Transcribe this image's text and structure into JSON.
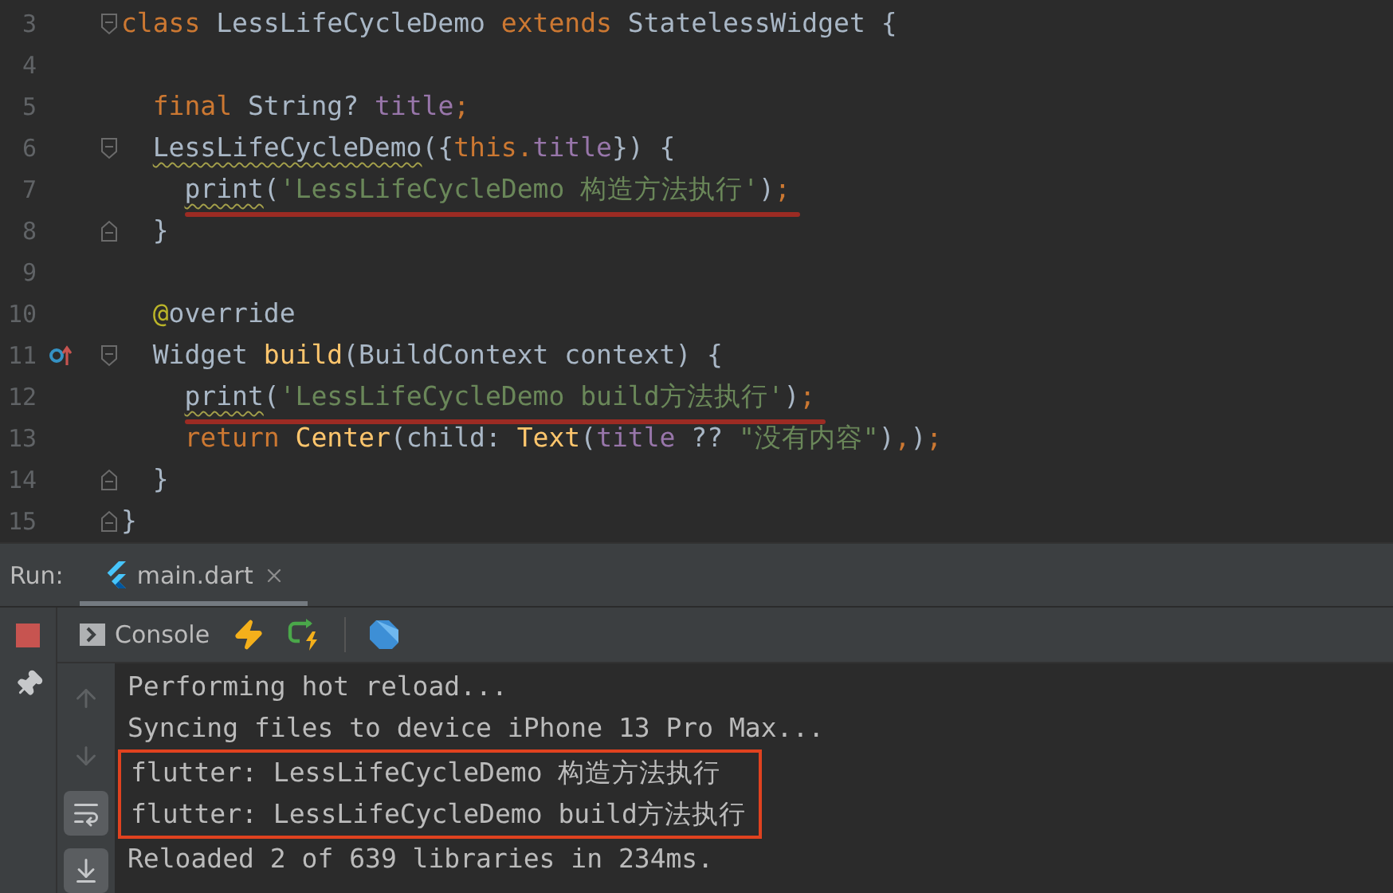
{
  "editor": {
    "lines": [
      {
        "number": "3",
        "fold_start": true,
        "tokens": [
          {
            "kind": "keyword",
            "text": "class "
          },
          {
            "kind": "plain",
            "text": "LessLifeCycleDemo "
          },
          {
            "kind": "keyword",
            "text": "extends "
          },
          {
            "kind": "plain",
            "text": "StatelessWidget {"
          }
        ],
        "children": [
          {
            "number": "4"
          },
          {
            "number": "5",
            "tokens": [
              {
                "kind": "keyword",
                "text": "final "
              },
              {
                "kind": "plain",
                "text": "String? "
              },
              {
                "kind": "field",
                "text": "title"
              },
              {
                "kind": "keyword",
                "text": ";"
              }
            ]
          },
          {
            "number": "6",
            "fold_start": true,
            "tokens": [
              {
                "kind": "plain",
                "text": "LessLifeCycleDemo",
                "warn": true
              },
              {
                "kind": "plain",
                "text": "({"
              },
              {
                "kind": "keyword",
                "text": "this."
              },
              {
                "kind": "field",
                "text": "title"
              },
              {
                "kind": "plain",
                "text": "}) {"
              }
            ],
            "children": [
              {
                "number": "7",
                "error": true,
                "tokens": [
                  {
                    "kind": "plain",
                    "text": "print",
                    "warn": true
                  },
                  {
                    "kind": "plain",
                    "text": "("
                  },
                  {
                    "kind": "string",
                    "text": "'LessLifeCycleDemo 构造方法执行'"
                  },
                  {
                    "kind": "plain",
                    "text": ")"
                  },
                  {
                    "kind": "keyword",
                    "text": ";"
                  }
                ]
              }
            ]
          },
          {
            "number": "8",
            "fold_end": true,
            "tokens": [
              {
                "kind": "plain",
                "text": "}"
              }
            ]
          },
          {
            "number": "9"
          },
          {
            "number": "10",
            "tokens": [
              {
                "kind": "annotation",
                "text": "@"
              },
              {
                "kind": "plain",
                "text": "override"
              }
            ]
          },
          {
            "number": "11",
            "fold_start": true,
            "overrides": true,
            "tokens": [
              {
                "kind": "plain",
                "text": "Widget "
              },
              {
                "kind": "function",
                "text": "build"
              },
              {
                "kind": "plain",
                "text": "(BuildContext context) {"
              }
            ],
            "children": [
              {
                "number": "12",
                "error": true,
                "tokens": [
                  {
                    "kind": "plain",
                    "text": "print",
                    "warn": true
                  },
                  {
                    "kind": "plain",
                    "text": "("
                  },
                  {
                    "kind": "string",
                    "text": "'LessLifeCycleDemo build方法执行'"
                  },
                  {
                    "kind": "plain",
                    "text": ")"
                  },
                  {
                    "kind": "keyword",
                    "text": ";"
                  }
                ]
              },
              {
                "number": "13",
                "tokens": [
                  {
                    "kind": "keyword",
                    "text": "return "
                  },
                  {
                    "kind": "function",
                    "text": "Center"
                  },
                  {
                    "kind": "plain",
                    "text": "(child: "
                  },
                  {
                    "kind": "function",
                    "text": "Text"
                  },
                  {
                    "kind": "plain",
                    "text": "("
                  },
                  {
                    "kind": "field",
                    "text": "title"
                  },
                  {
                    "kind": "plain",
                    "text": " ?? "
                  },
                  {
                    "kind": "string",
                    "text": "\"没有内容\""
                  },
                  {
                    "kind": "plain",
                    "text": ")"
                  },
                  {
                    "kind": "keyword",
                    "text": ","
                  },
                  {
                    "kind": "plain",
                    "text": ")"
                  },
                  {
                    "kind": "keyword",
                    "text": ";"
                  }
                ]
              }
            ]
          },
          {
            "number": "14",
            "fold_end": true,
            "tokens": [
              {
                "kind": "plain",
                "text": "}"
              }
            ]
          }
        ]
      },
      {
        "number": "15",
        "fold_end": true,
        "tokens": [
          {
            "kind": "plain",
            "text": "}"
          }
        ]
      }
    ]
  },
  "run_panel": {
    "label": "Run:",
    "tabs": [
      {
        "label": "main.dart",
        "selected": true
      }
    ],
    "side_actions": [
      {
        "kind": "stop"
      },
      {
        "kind": "pin"
      }
    ],
    "toolbar": {
      "tabs": [
        {
          "label": "Console",
          "selected": true
        }
      ],
      "actions": [
        {
          "kind": "hot-reload"
        },
        {
          "kind": "hot-restart"
        },
        {
          "kind": "devtools"
        }
      ]
    },
    "console_tools": [
      {
        "kind": "up",
        "disabled": true
      },
      {
        "kind": "down",
        "disabled": true
      },
      {
        "kind": "soft-wrap",
        "on": true
      },
      {
        "kind": "scroll-end",
        "on": true
      }
    ],
    "console_lines": [
      {
        "text": "Performing hot reload...",
        "highlighted": false
      },
      {
        "text": "Syncing files to device iPhone 13 Pro Max...",
        "highlighted": false
      },
      {
        "text": "flutter: LessLifeCycleDemo 构造方法执行",
        "highlighted": true
      },
      {
        "text": "flutter: LessLifeCycleDemo build方法执行",
        "highlighted": true
      },
      {
        "text": "Reloaded 2 of 639 libraries in 234ms.",
        "highlighted": false
      }
    ]
  }
}
